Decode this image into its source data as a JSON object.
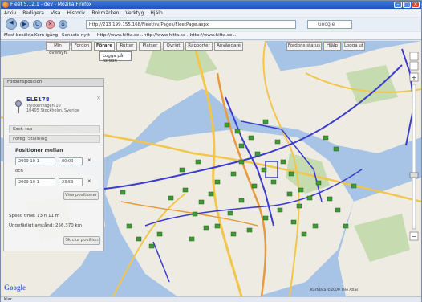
{
  "window": {
    "title": "Fleet 5.12.1 - dev - Mozilla Firefox"
  },
  "menu": [
    "Arkiv",
    "Redigera",
    "Visa",
    "Historik",
    "Bokmärken",
    "Verktyg",
    "Hjälp"
  ],
  "nav": {
    "back": "◀",
    "forward": "▶",
    "reload": "C",
    "stop": "✕",
    "home": "⌂",
    "url": "http://213.199.155.168/Fleet/sv/Pages/FleetPage.aspx",
    "search_placeholder": "Google"
  },
  "bookmarks": [
    "Mest besökta",
    "Kom igång",
    "Senaste nytt",
    "http://www.hitta.se ...",
    "http://www.hitta.se ...",
    "http://www.hitta.se ..."
  ],
  "tabs": [
    "Min översyn",
    "Fordon",
    "Förare",
    "Rutter",
    "Platser",
    "Övrigt",
    "Rapporter",
    "Användare",
    "Fordons status",
    "Hjälp",
    "Logga ut"
  ],
  "dropdown_label": "Logga på fordon",
  "panel": {
    "header": "Fordonsposition",
    "vehicle_id": "ELE178",
    "address_line1": "Tryckerivägen 10",
    "address_line2": "10405 Stockholm, Sverige",
    "row_cost": "Kost. rap",
    "row_previous": "Föreg. Ställning",
    "position_heading": "Positioner mellan",
    "from_date": "2009-10-1",
    "from_time": "00:00",
    "to_label": "och",
    "to_date": "2009-10-1",
    "to_time": "23:59",
    "show_button": "Visa positioner",
    "speed_label": "Speed time: 13 h 11 m",
    "distance_label": "Ungefärligt avstånd: 256.370 km",
    "send_button": "Skicka position"
  },
  "map": {
    "logo": "Google",
    "copyright": "Kartdata ©2009 Tele Atlas"
  },
  "status": {
    "text": "Klar"
  },
  "colors": {
    "water": "#a7c3e6",
    "land": "#eeebe3",
    "park": "#c6dbb0",
    "route": "#3b3bcc",
    "road_major": "#f1c64a",
    "road_orange": "#e89a3c",
    "marker": "#3f9a35"
  }
}
